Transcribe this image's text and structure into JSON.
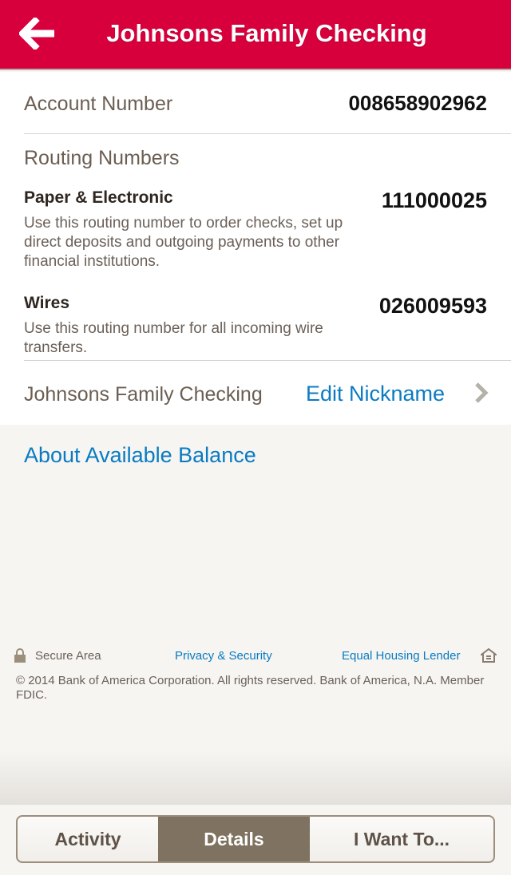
{
  "header": {
    "title": "Johnsons Family Checking",
    "back_icon": "back-arrow-icon",
    "color": "#d8003c"
  },
  "account": {
    "label": "Account Number",
    "number": "008658902962"
  },
  "routing": {
    "title": "Routing Numbers",
    "items": [
      {
        "name": "Paper & Electronic",
        "number": "111000025",
        "description": "Use this routing number to order checks, set up direct deposits and outgoing payments to other financial institutions."
      },
      {
        "name": "Wires",
        "number": "026009593",
        "description": "Use this routing number for all incoming wire transfers."
      }
    ]
  },
  "nickname": {
    "value": "Johnsons Family Checking",
    "edit_label": "Edit Nickname",
    "chevron_icon": "chevron-right-icon"
  },
  "about_link": "About Available Balance",
  "footer": {
    "secure": "Secure Area",
    "privacy": "Privacy & Security",
    "equal_housing": "Equal Housing Lender",
    "copyright": "© 2014 Bank of America Corporation. All rights reserved. Bank of America, N.A. Member FDIC."
  },
  "tabs": [
    {
      "label": "Activity",
      "selected": false
    },
    {
      "label": "Details",
      "selected": true
    },
    {
      "label": "I Want To...",
      "selected": false
    }
  ],
  "colors": {
    "link": "#0a7bc2",
    "selected_tab": "#7f7260"
  }
}
